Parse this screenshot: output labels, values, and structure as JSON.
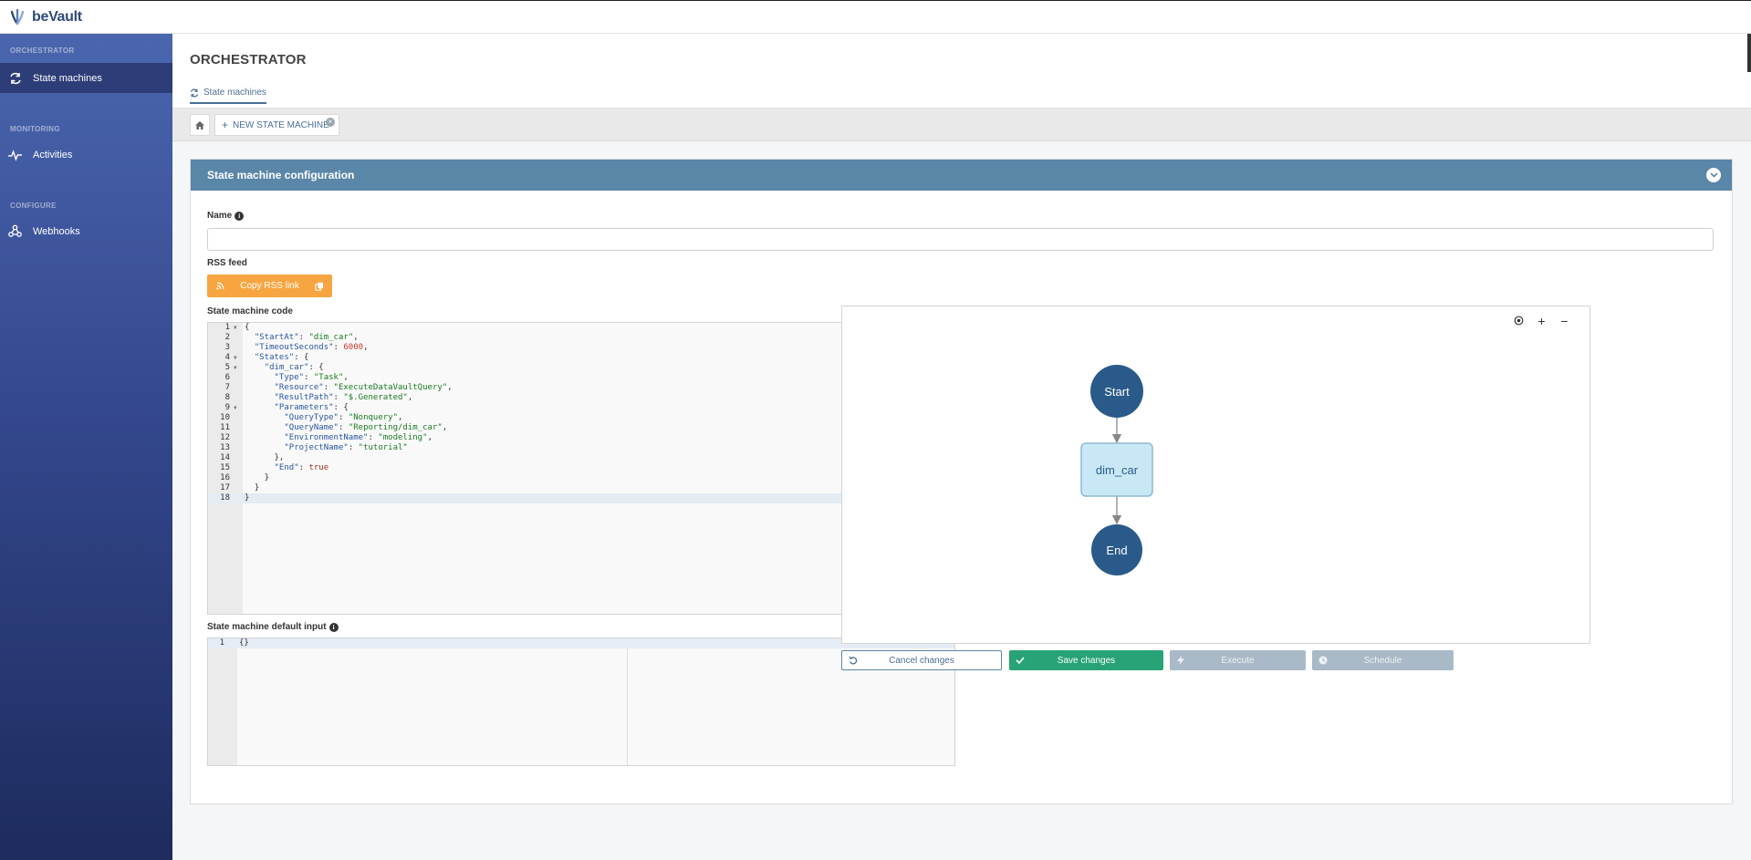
{
  "app": {
    "logo_text": "beVault"
  },
  "sidebar": {
    "sections": [
      {
        "title": "ORCHESTRATOR",
        "items": [
          {
            "label": "State machines",
            "icon": "arrows-cycle-icon",
            "active": true
          }
        ]
      },
      {
        "title": "MONITORING",
        "items": [
          {
            "label": "Activities",
            "icon": "pulse-icon",
            "active": false
          }
        ]
      },
      {
        "title": "CONFIGURE",
        "items": [
          {
            "label": "Webhooks",
            "icon": "webhook-icon",
            "active": false
          }
        ]
      }
    ]
  },
  "header": {
    "title": "ORCHESTRATOR",
    "subnav_label": "State machines"
  },
  "tabs": {
    "new_tab_label": "NEW STATE MACHINE"
  },
  "panel": {
    "title": "State machine configuration",
    "name_label": "Name",
    "name_value": "",
    "rss_label": "RSS feed",
    "rss_button": "Copy RSS link",
    "code_label": "State machine code",
    "default_input_label": "State machine default input",
    "code_lines": [
      "{",
      "  \"StartAt\": \"dim_car\",",
      "  \"TimeoutSeconds\": 6000,",
      "  \"States\": {",
      "    \"dim_car\": {",
      "      \"Type\": \"Task\",",
      "      \"Resource\": \"ExecuteDataVaultQuery\",",
      "      \"ResultPath\": \"$.Generated\",",
      "      \"Parameters\": {",
      "        \"QueryType\": \"Nonquery\",",
      "        \"QueryName\": \"Reporting/dim_car\",",
      "        \"EnvironmentName\": \"modeling\",",
      "        \"ProjectName\": \"tutorial\"",
      "      },",
      "      \"End\": true",
      "    }",
      "  }",
      "}"
    ],
    "fold_lines": [
      1,
      4,
      5,
      9
    ],
    "active_code_line": 18,
    "input_lines": [
      "{}"
    ]
  },
  "diagram": {
    "nodes": [
      {
        "id": "start",
        "label": "Start",
        "kind": "terminal"
      },
      {
        "id": "dim_car",
        "label": "dim_car",
        "kind": "task"
      },
      {
        "id": "end",
        "label": "End",
        "kind": "terminal"
      }
    ],
    "edges": [
      [
        "start",
        "dim_car"
      ],
      [
        "dim_car",
        "end"
      ]
    ],
    "colors": {
      "terminal": "#2a5a8a",
      "task_fill": "#c9e8f5",
      "task_border": "#8fb8d4",
      "task_text": "#2a5a8a",
      "edge": "#888888"
    }
  },
  "actions": {
    "cancel": "Cancel changes",
    "save": "Save changes",
    "execute": "Execute",
    "schedule": "Schedule"
  }
}
